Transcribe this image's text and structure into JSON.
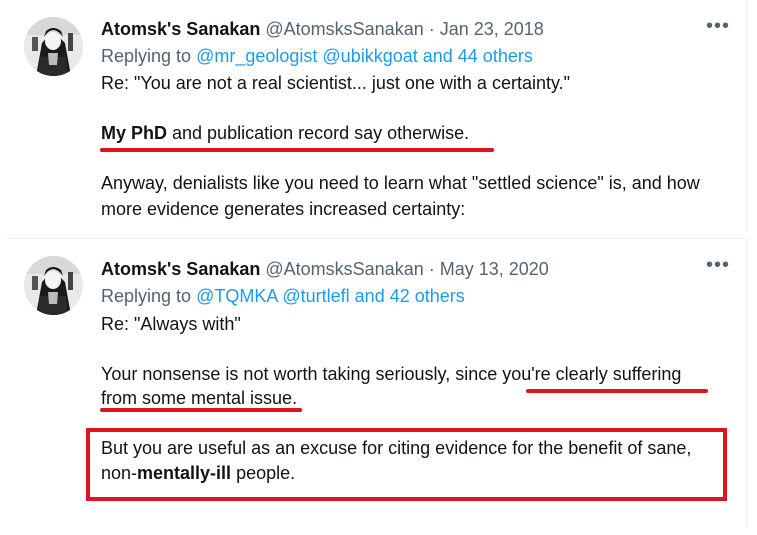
{
  "tweet1": {
    "display_name": "Atomsk's Sanakan",
    "handle": "@AtomsksSanakan",
    "separator": " · ",
    "date": "Jan 23, 2018",
    "more_label": "•••",
    "replying_prefix": "Replying to ",
    "reply_user_1": "@mr_geologist",
    "reply_user_2": "@ubikkgoat",
    "reply_others": "and 44 others",
    "line1": "Re: \"You are not a real scientist... just one with a certainty.\"",
    "line2_bold": "My PhD",
    "line2_rest": " and publication record say otherwise.",
    "line3": "Anyway, denialists like you need to learn what \"settled science\" is, and how",
    "line4": "more evidence generates increased certainty:"
  },
  "tweet2": {
    "display_name": "Atomsk's Sanakan",
    "handle": "@AtomsksSanakan",
    "separator": " · ",
    "date": "May 13, 2020",
    "more_label": "•••",
    "replying_prefix": "Replying to ",
    "reply_user_1": "@TQMKA",
    "reply_user_2": "@turtlefl",
    "reply_others": "and 42 others",
    "line1": "Re: \"Always with\"",
    "line2": "Your nonsense is not worth taking seriously, since you're clearly suffering",
    "line3": "from some mental issue.",
    "line4": "But you are useful as an excuse for citing evidence for the benefit of sane,",
    "line5_prefix": "non-",
    "line5_bold": "mentally-ill",
    "line5_rest": " people."
  },
  "colors": {
    "text": "#0f1419",
    "muted": "#536471",
    "link": "#1d9bf0",
    "annotation": "#e0141e"
  }
}
